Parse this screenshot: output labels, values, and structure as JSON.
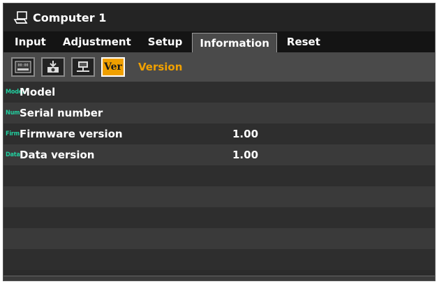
{
  "window": {
    "title": "Computer 1",
    "icon": "pc-source-icon"
  },
  "tabs": [
    {
      "label": "Input",
      "active": false
    },
    {
      "label": "Adjustment",
      "active": false
    },
    {
      "label": "Setup",
      "active": false
    },
    {
      "label": "Information",
      "active": true
    },
    {
      "label": "Reset",
      "active": false
    }
  ],
  "sub_icons": [
    {
      "name": "usage-time-icon",
      "active": false
    },
    {
      "name": "source-icon",
      "active": false
    },
    {
      "name": "wired-lan-icon",
      "active": false
    },
    {
      "name": "version-icon",
      "label": "Ver",
      "active": true
    }
  ],
  "section": {
    "label": "Version"
  },
  "rows": [
    {
      "abbr": "Model",
      "label": "Model",
      "value": ""
    },
    {
      "abbr": "Num",
      "label": "Serial number",
      "value": ""
    },
    {
      "abbr": "Firm",
      "label": "Firmware version",
      "value": "1.00"
    },
    {
      "abbr": "Data",
      "label": "Data version",
      "value": "1.00"
    }
  ],
  "empty_rows": 5,
  "colors": {
    "accent": "#f0a000",
    "abbr": "#22d0a0",
    "background": "#2b2b2b"
  }
}
